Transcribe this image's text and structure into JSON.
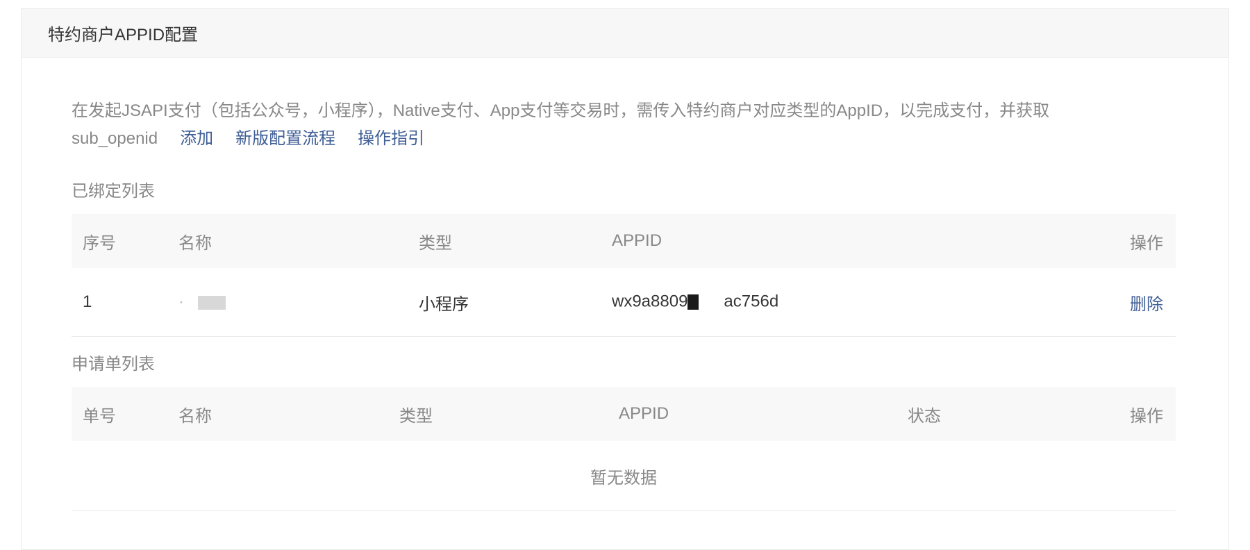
{
  "panel": {
    "title": "特约商户APPID配置"
  },
  "intro": {
    "text_line1": "在发起JSAPI支付（包括公众号，小程序），Native支付、App支付等交易时，需传入特约商户对应类型的AppID，以完成支付，并获取",
    "text_line2": "sub_openid",
    "links": {
      "add": "添加",
      "new_flow": "新版配置流程",
      "guide": "操作指引"
    }
  },
  "bound": {
    "title": "已绑定列表",
    "columns": {
      "seq": "序号",
      "name": "名称",
      "type": "类型",
      "appid": "APPID",
      "action": "操作"
    },
    "rows": [
      {
        "seq": "1",
        "name_prefix": "·",
        "type": "小程序",
        "appid_prefix": "wx9a8809",
        "appid_suffix": "ac756d",
        "action": "删除"
      }
    ]
  },
  "applications": {
    "title": "申请单列表",
    "columns": {
      "no": "单号",
      "name": "名称",
      "type": "类型",
      "appid": "APPID",
      "status": "状态",
      "action": "操作"
    },
    "empty": "暂无数据"
  }
}
